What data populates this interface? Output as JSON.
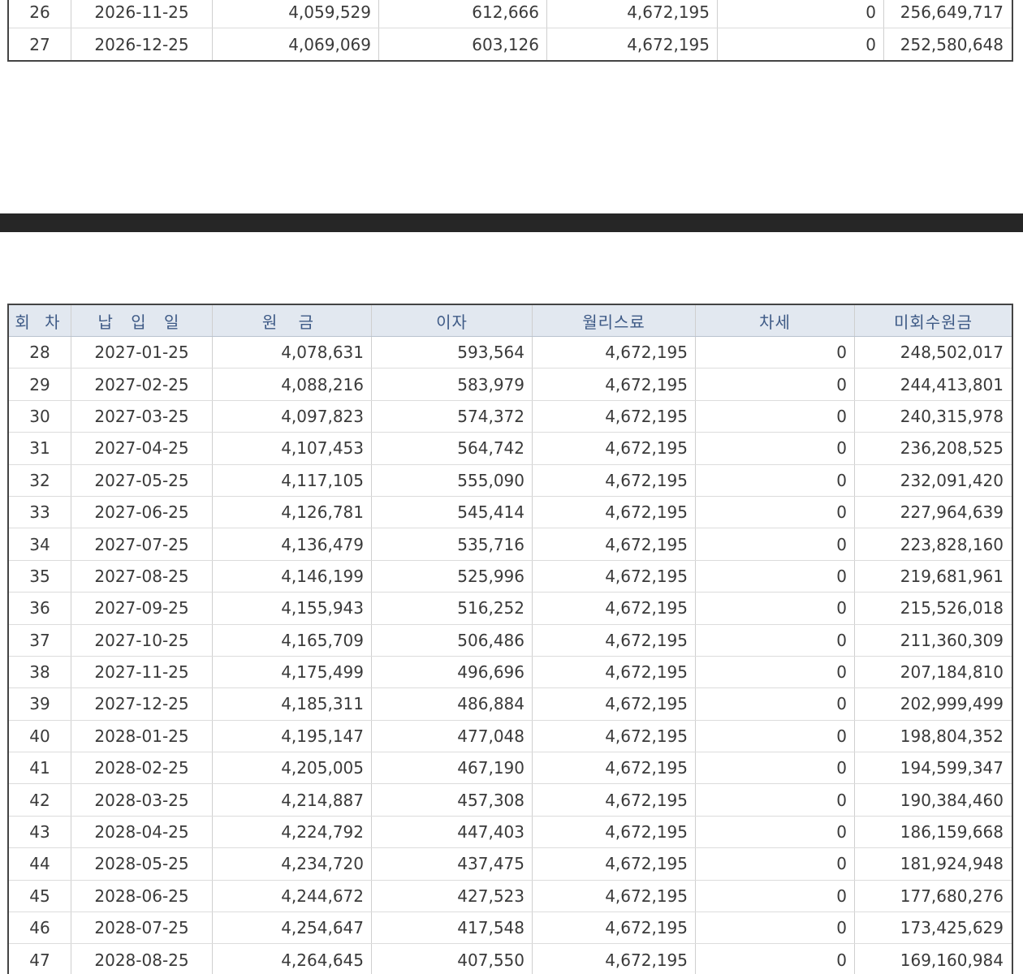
{
  "top_rows": [
    [
      "26",
      "2026-11-25",
      "4,059,529",
      "612,666",
      "4,672,195",
      "0",
      "256,649,717"
    ],
    [
      "27",
      "2026-12-25",
      "4,069,069",
      "603,126",
      "4,672,195",
      "0",
      "252,580,648"
    ]
  ],
  "headers": [
    "회 차",
    "납 입 일",
    "원 금",
    "이자",
    "월리스료",
    "차세",
    "미회수원금"
  ],
  "rows": [
    [
      "28",
      "2027-01-25",
      "4,078,631",
      "593,564",
      "4,672,195",
      "0",
      "248,502,017"
    ],
    [
      "29",
      "2027-02-25",
      "4,088,216",
      "583,979",
      "4,672,195",
      "0",
      "244,413,801"
    ],
    [
      "30",
      "2027-03-25",
      "4,097,823",
      "574,372",
      "4,672,195",
      "0",
      "240,315,978"
    ],
    [
      "31",
      "2027-04-25",
      "4,107,453",
      "564,742",
      "4,672,195",
      "0",
      "236,208,525"
    ],
    [
      "32",
      "2027-05-25",
      "4,117,105",
      "555,090",
      "4,672,195",
      "0",
      "232,091,420"
    ],
    [
      "33",
      "2027-06-25",
      "4,126,781",
      "545,414",
      "4,672,195",
      "0",
      "227,964,639"
    ],
    [
      "34",
      "2027-07-25",
      "4,136,479",
      "535,716",
      "4,672,195",
      "0",
      "223,828,160"
    ],
    [
      "35",
      "2027-08-25",
      "4,146,199",
      "525,996",
      "4,672,195",
      "0",
      "219,681,961"
    ],
    [
      "36",
      "2027-09-25",
      "4,155,943",
      "516,252",
      "4,672,195",
      "0",
      "215,526,018"
    ],
    [
      "37",
      "2027-10-25",
      "4,165,709",
      "506,486",
      "4,672,195",
      "0",
      "211,360,309"
    ],
    [
      "38",
      "2027-11-25",
      "4,175,499",
      "496,696",
      "4,672,195",
      "0",
      "207,184,810"
    ],
    [
      "39",
      "2027-12-25",
      "4,185,311",
      "486,884",
      "4,672,195",
      "0",
      "202,999,499"
    ],
    [
      "40",
      "2028-01-25",
      "4,195,147",
      "477,048",
      "4,672,195",
      "0",
      "198,804,352"
    ],
    [
      "41",
      "2028-02-25",
      "4,205,005",
      "467,190",
      "4,672,195",
      "0",
      "194,599,347"
    ],
    [
      "42",
      "2028-03-25",
      "4,214,887",
      "457,308",
      "4,672,195",
      "0",
      "190,384,460"
    ],
    [
      "43",
      "2028-04-25",
      "4,224,792",
      "447,403",
      "4,672,195",
      "0",
      "186,159,668"
    ],
    [
      "44",
      "2028-05-25",
      "4,234,720",
      "437,475",
      "4,672,195",
      "0",
      "181,924,948"
    ],
    [
      "45",
      "2028-06-25",
      "4,244,672",
      "427,523",
      "4,672,195",
      "0",
      "177,680,276"
    ],
    [
      "46",
      "2028-07-25",
      "4,254,647",
      "417,548",
      "4,672,195",
      "0",
      "173,425,629"
    ],
    [
      "47",
      "2028-08-25",
      "4,264,645",
      "407,550",
      "4,672,195",
      "0",
      "169,160,984"
    ]
  ]
}
